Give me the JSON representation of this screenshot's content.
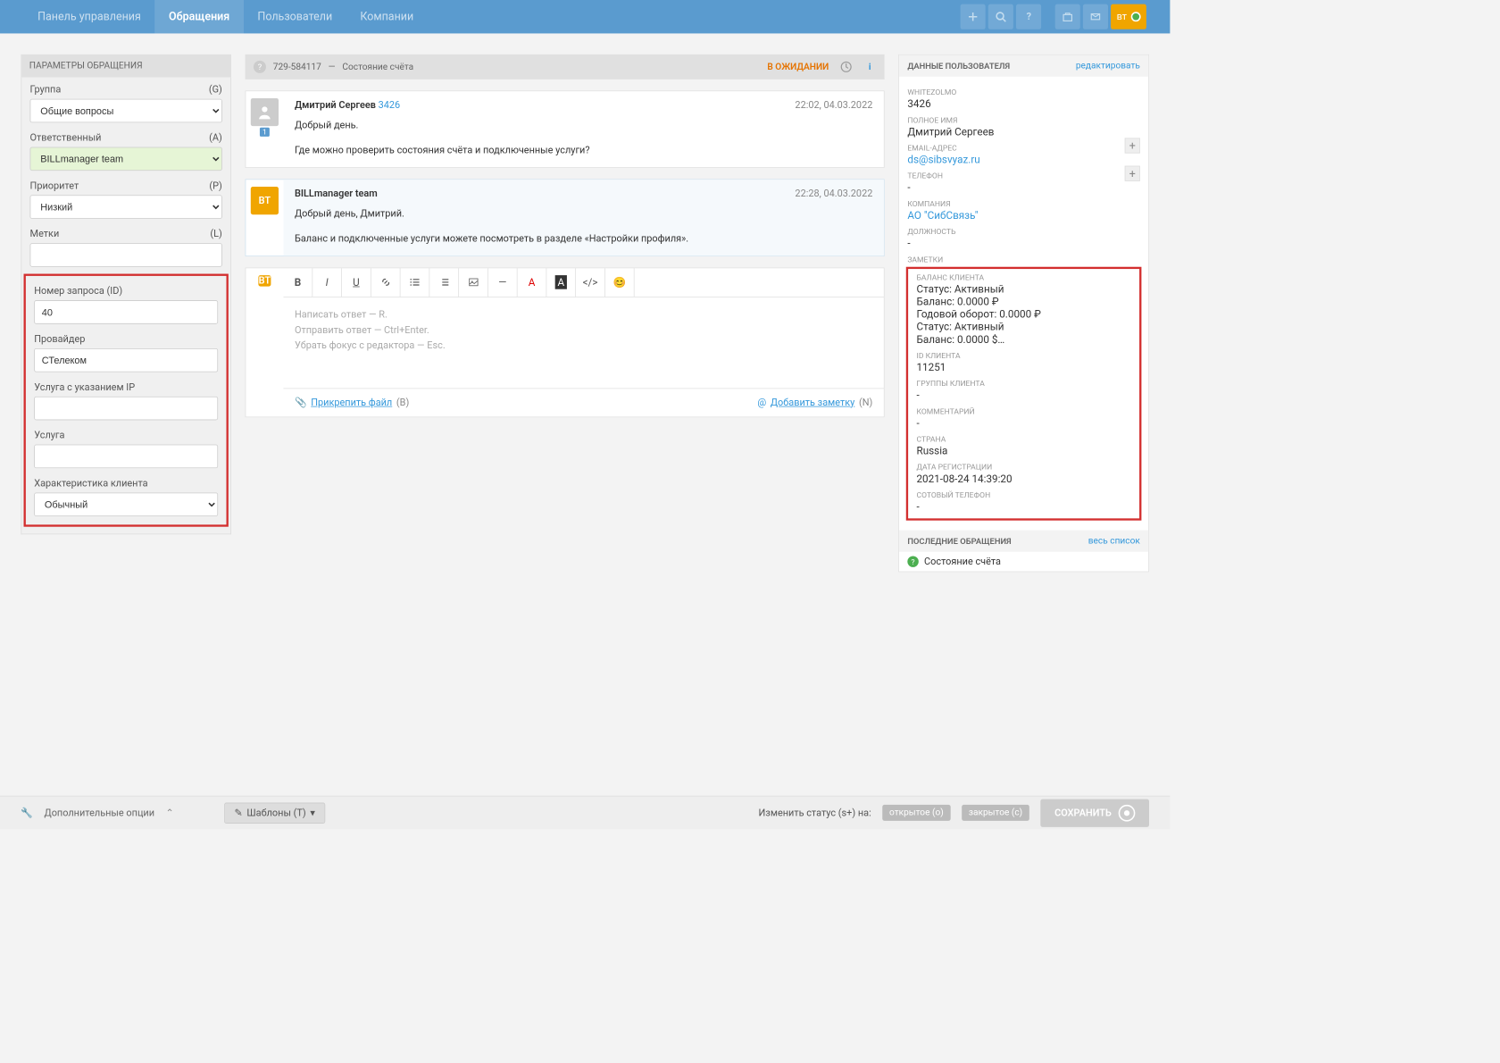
{
  "nav": {
    "items": [
      "Панель управления",
      "Обращения",
      "Пользователи",
      "Компании"
    ],
    "user_badge": "вт"
  },
  "sidebar": {
    "title": "ПАРАМЕТРЫ ОБРАЩЕНИЯ",
    "group": {
      "label": "Группа",
      "hotkey": "(G)",
      "value": "Общие вопросы"
    },
    "assignee": {
      "label": "Ответственный",
      "hotkey": "(A)",
      "value": "BILLmanager team"
    },
    "priority": {
      "label": "Приоритет",
      "hotkey": "(P)",
      "value": "Низкий"
    },
    "tags": {
      "label": "Метки",
      "hotkey": "(L)",
      "value": ""
    },
    "request_id": {
      "label": "Номер запроса (ID)",
      "value": "40"
    },
    "provider": {
      "label": "Провайдер",
      "value": "СТелеком"
    },
    "service_ip": {
      "label": "Услуга с указанием IP",
      "value": ""
    },
    "service": {
      "label": "Услуга",
      "value": ""
    },
    "client_char": {
      "label": "Характеристика клиента",
      "value": "Обычный"
    }
  },
  "ticket": {
    "id": "729-584117",
    "title": "Состояние счёта",
    "status": "В ОЖИДАНИИ"
  },
  "messages": [
    {
      "avatar": "user",
      "author": "Дмитрий Сергеев",
      "author_id": "3426",
      "time": "22:02, 04.03.2022",
      "lines": [
        "Добрый день.",
        "Где можно проверить состояния счёта и подключенные услуги?"
      ],
      "badge": "1"
    },
    {
      "avatar": "BT",
      "author": "BILLmanager team",
      "time": "22:28, 04.03.2022",
      "lines": [
        "Добрый день, Дмитрий.",
        "Баланс и подключенные услуги можете посмотреть в разделе «Настройки профиля»."
      ]
    }
  ],
  "editor": {
    "avatar": "BT",
    "placeholder_lines": [
      "Написать ответ — R.",
      "Отправить ответ — Ctrl+Enter.",
      "Убрать фокус с редактора — Esc."
    ],
    "attach": "Прикрепить файл",
    "attach_hk": "(B)",
    "add_note": "Добавить заметку",
    "add_note_hk": "(N)"
  },
  "rhs": {
    "user_data_hdr": "ДАННЫЕ ПОЛЬЗОВАТЕЛЯ",
    "edit_link": "редактировать",
    "whitezolmo_label": "WHITEZOLMO",
    "whitezolmo_value": "3426",
    "fullname_label": "ПОЛНОЕ ИМЯ",
    "fullname_value": "Дмитрий Сергеев",
    "email_label": "EMAIL-АДРЕС",
    "email_value": "ds@sibsvyaz.ru",
    "phone_label": "ТЕЛЕФОН",
    "phone_value": "-",
    "company_label": "КОМПАНИЯ",
    "company_value": "АО \"СибСвязь\"",
    "position_label": "ДОЛЖНОСТЬ",
    "position_value": "-",
    "notes_label": "ЗАМЕТКИ",
    "balance_label": "БАЛАНС КЛИЕНТА",
    "balance_lines": [
      "Статус: Активный",
      "Баланс: 0.0000 ₽",
      "Годовой оборот: 0.0000 ₽",
      "Статус: Активный",
      "Баланс: 0.0000 $…"
    ],
    "client_id_label": "ID КЛИЕНТА",
    "client_id_value": "11251",
    "client_groups_label": "ГРУППЫ КЛИЕНТА",
    "client_groups_value": "-",
    "comment_label": "КОММЕНТАРИЙ",
    "comment_value": "-",
    "country_label": "СТРАНА",
    "country_value": "Russia",
    "reg_date_label": "ДАТА РЕГИСТРАЦИИ",
    "reg_date_value": "2021-08-24 14:39:20",
    "mobile_label": "СОТОВЫЙ ТЕЛЕФОН",
    "mobile_value": "-",
    "recent_hdr": "ПОСЛЕДНИЕ ОБРАЩЕНИЯ",
    "recent_all": "весь список",
    "recent_item": "Состояние счёта"
  },
  "bottom": {
    "extra_opts": "Дополнительные опции",
    "templates": "Шаблоны (T)",
    "change_status": "Изменить статус (s+) на:",
    "open": "открытое (o)",
    "closed": "закрытое (c)",
    "save": "СОХРАНИТЬ"
  }
}
